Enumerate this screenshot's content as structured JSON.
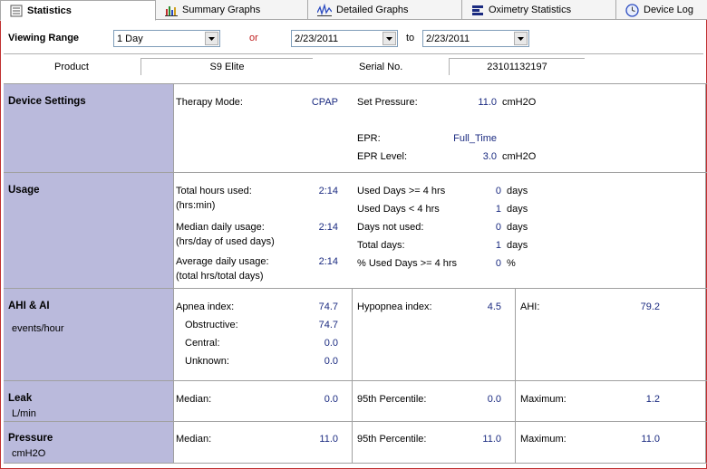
{
  "tabs": [
    {
      "label": "Statistics",
      "icon": "statistics-icon"
    },
    {
      "label": "Summary Graphs",
      "icon": "bar-chart-icon"
    },
    {
      "label": "Detailed Graphs",
      "icon": "waveform-icon"
    },
    {
      "label": "Oximetry Statistics",
      "icon": "oximetry-icon"
    },
    {
      "label": "Device Log",
      "icon": "clock-icon"
    }
  ],
  "viewing_range": {
    "label": "Viewing Range",
    "period": "1 Day",
    "or_label": "or",
    "from_date": "2/23/2011",
    "to_label": "to",
    "to_date": "2/23/2011"
  },
  "product": {
    "label": "Product",
    "value": "S9 Elite",
    "serial_label": "Serial No.",
    "serial_value": "23101132197"
  },
  "device_settings": {
    "title": "Device Settings",
    "therapy_mode_label": "Therapy Mode:",
    "therapy_mode_value": "CPAP",
    "set_pressure_label": "Set Pressure:",
    "set_pressure_value": "11.0",
    "set_pressure_unit": "cmH2O",
    "epr_label": "EPR:",
    "epr_value": "Full_Time",
    "epr_level_label": "EPR Level:",
    "epr_level_value": "3.0",
    "epr_level_unit": "cmH2O"
  },
  "usage": {
    "title": "Usage",
    "total_hours_label": "Total hours used:",
    "total_hours_sub": "(hrs:min)",
    "total_hours_value": "2:14",
    "median_label": "Median daily usage:",
    "median_sub": "(hrs/day of used days)",
    "median_value": "2:14",
    "average_label": "Average daily usage:",
    "average_sub": "(total hrs/total days)",
    "average_value": "2:14",
    "right": [
      {
        "label": "Used Days >= 4 hrs",
        "value": "0",
        "unit": "days"
      },
      {
        "label": "Used Days < 4 hrs",
        "value": "1",
        "unit": "days"
      },
      {
        "label": "Days not used:",
        "value": "0",
        "unit": "days"
      },
      {
        "label": "Total days:",
        "value": "1",
        "unit": "days"
      },
      {
        "label": "% Used Days >= 4 hrs",
        "value": "0",
        "unit": "%"
      }
    ]
  },
  "ahi": {
    "title": "AHI & AI",
    "subtitle": "events/hour",
    "apnea_label": "Apnea index:",
    "apnea_value": "74.7",
    "obstructive_label": "Obstructive:",
    "obstructive_value": "74.7",
    "central_label": "Central:",
    "central_value": "0.0",
    "unknown_label": "Unknown:",
    "unknown_value": "0.0",
    "hypopnea_label": "Hypopnea index:",
    "hypopnea_value": "4.5",
    "ahi_label": "AHI:",
    "ahi_value": "79.2"
  },
  "leak": {
    "title": "Leak",
    "subtitle": "L/min",
    "median_label": "Median:",
    "median_value": "0.0",
    "p95_label": "95th Percentile:",
    "p95_value": "0.0",
    "max_label": "Maximum:",
    "max_value": "1.2"
  },
  "pressure": {
    "title": "Pressure",
    "subtitle": "cmH2O",
    "median_label": "Median:",
    "median_value": "11.0",
    "p95_label": "95th Percentile:",
    "p95_value": "11.0",
    "max_label": "Maximum:",
    "max_value": "11.0"
  },
  "colors": {
    "sidebar": "#babadc",
    "value_text": "#1a2a80",
    "or_text": "#c02020"
  }
}
